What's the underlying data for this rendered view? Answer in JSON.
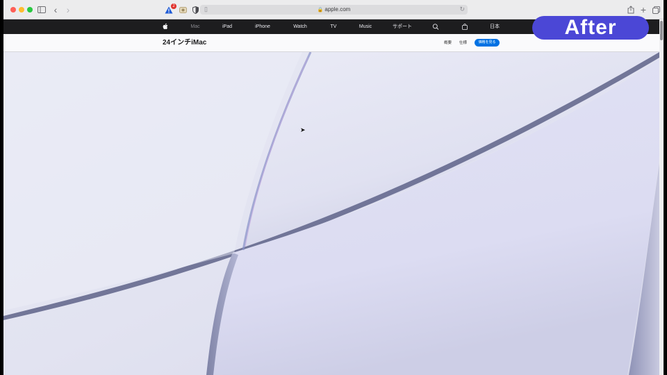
{
  "browser": {
    "url": "apple.com",
    "warning_badge_count": "2",
    "icons": {
      "sidebar": "sidebar-icon",
      "back": "chevron-left-icon",
      "forward": "chevron-right-icon",
      "warning": "warning-icon",
      "extension": "extension-icon",
      "shield": "shield-icon",
      "page": "page-icon",
      "lock": "lock-icon",
      "reload": "reload-icon",
      "share": "share-icon",
      "new_tab": "plus-icon",
      "tabs": "tabs-overview-icon"
    }
  },
  "global_nav": {
    "apple_icon": "apple-logo-icon",
    "items": [
      "Mac",
      "iPad",
      "iPhone",
      "Watch",
      "TV",
      "Music",
      "サポート"
    ],
    "search_icon": "search-icon",
    "bag_icon": "shopping-bag-icon",
    "region": "日本"
  },
  "local_nav": {
    "title": "24インチiMac",
    "overview": "概要",
    "specs": "仕様",
    "buy": "価格を見る"
  },
  "overlay": {
    "label": "After"
  },
  "colors": {
    "global_nav_bg": "#1d1d1f",
    "buy_button": "#0071e3",
    "overlay_badge": "#4b47d6",
    "hero_bg": "#e6e6f1"
  }
}
